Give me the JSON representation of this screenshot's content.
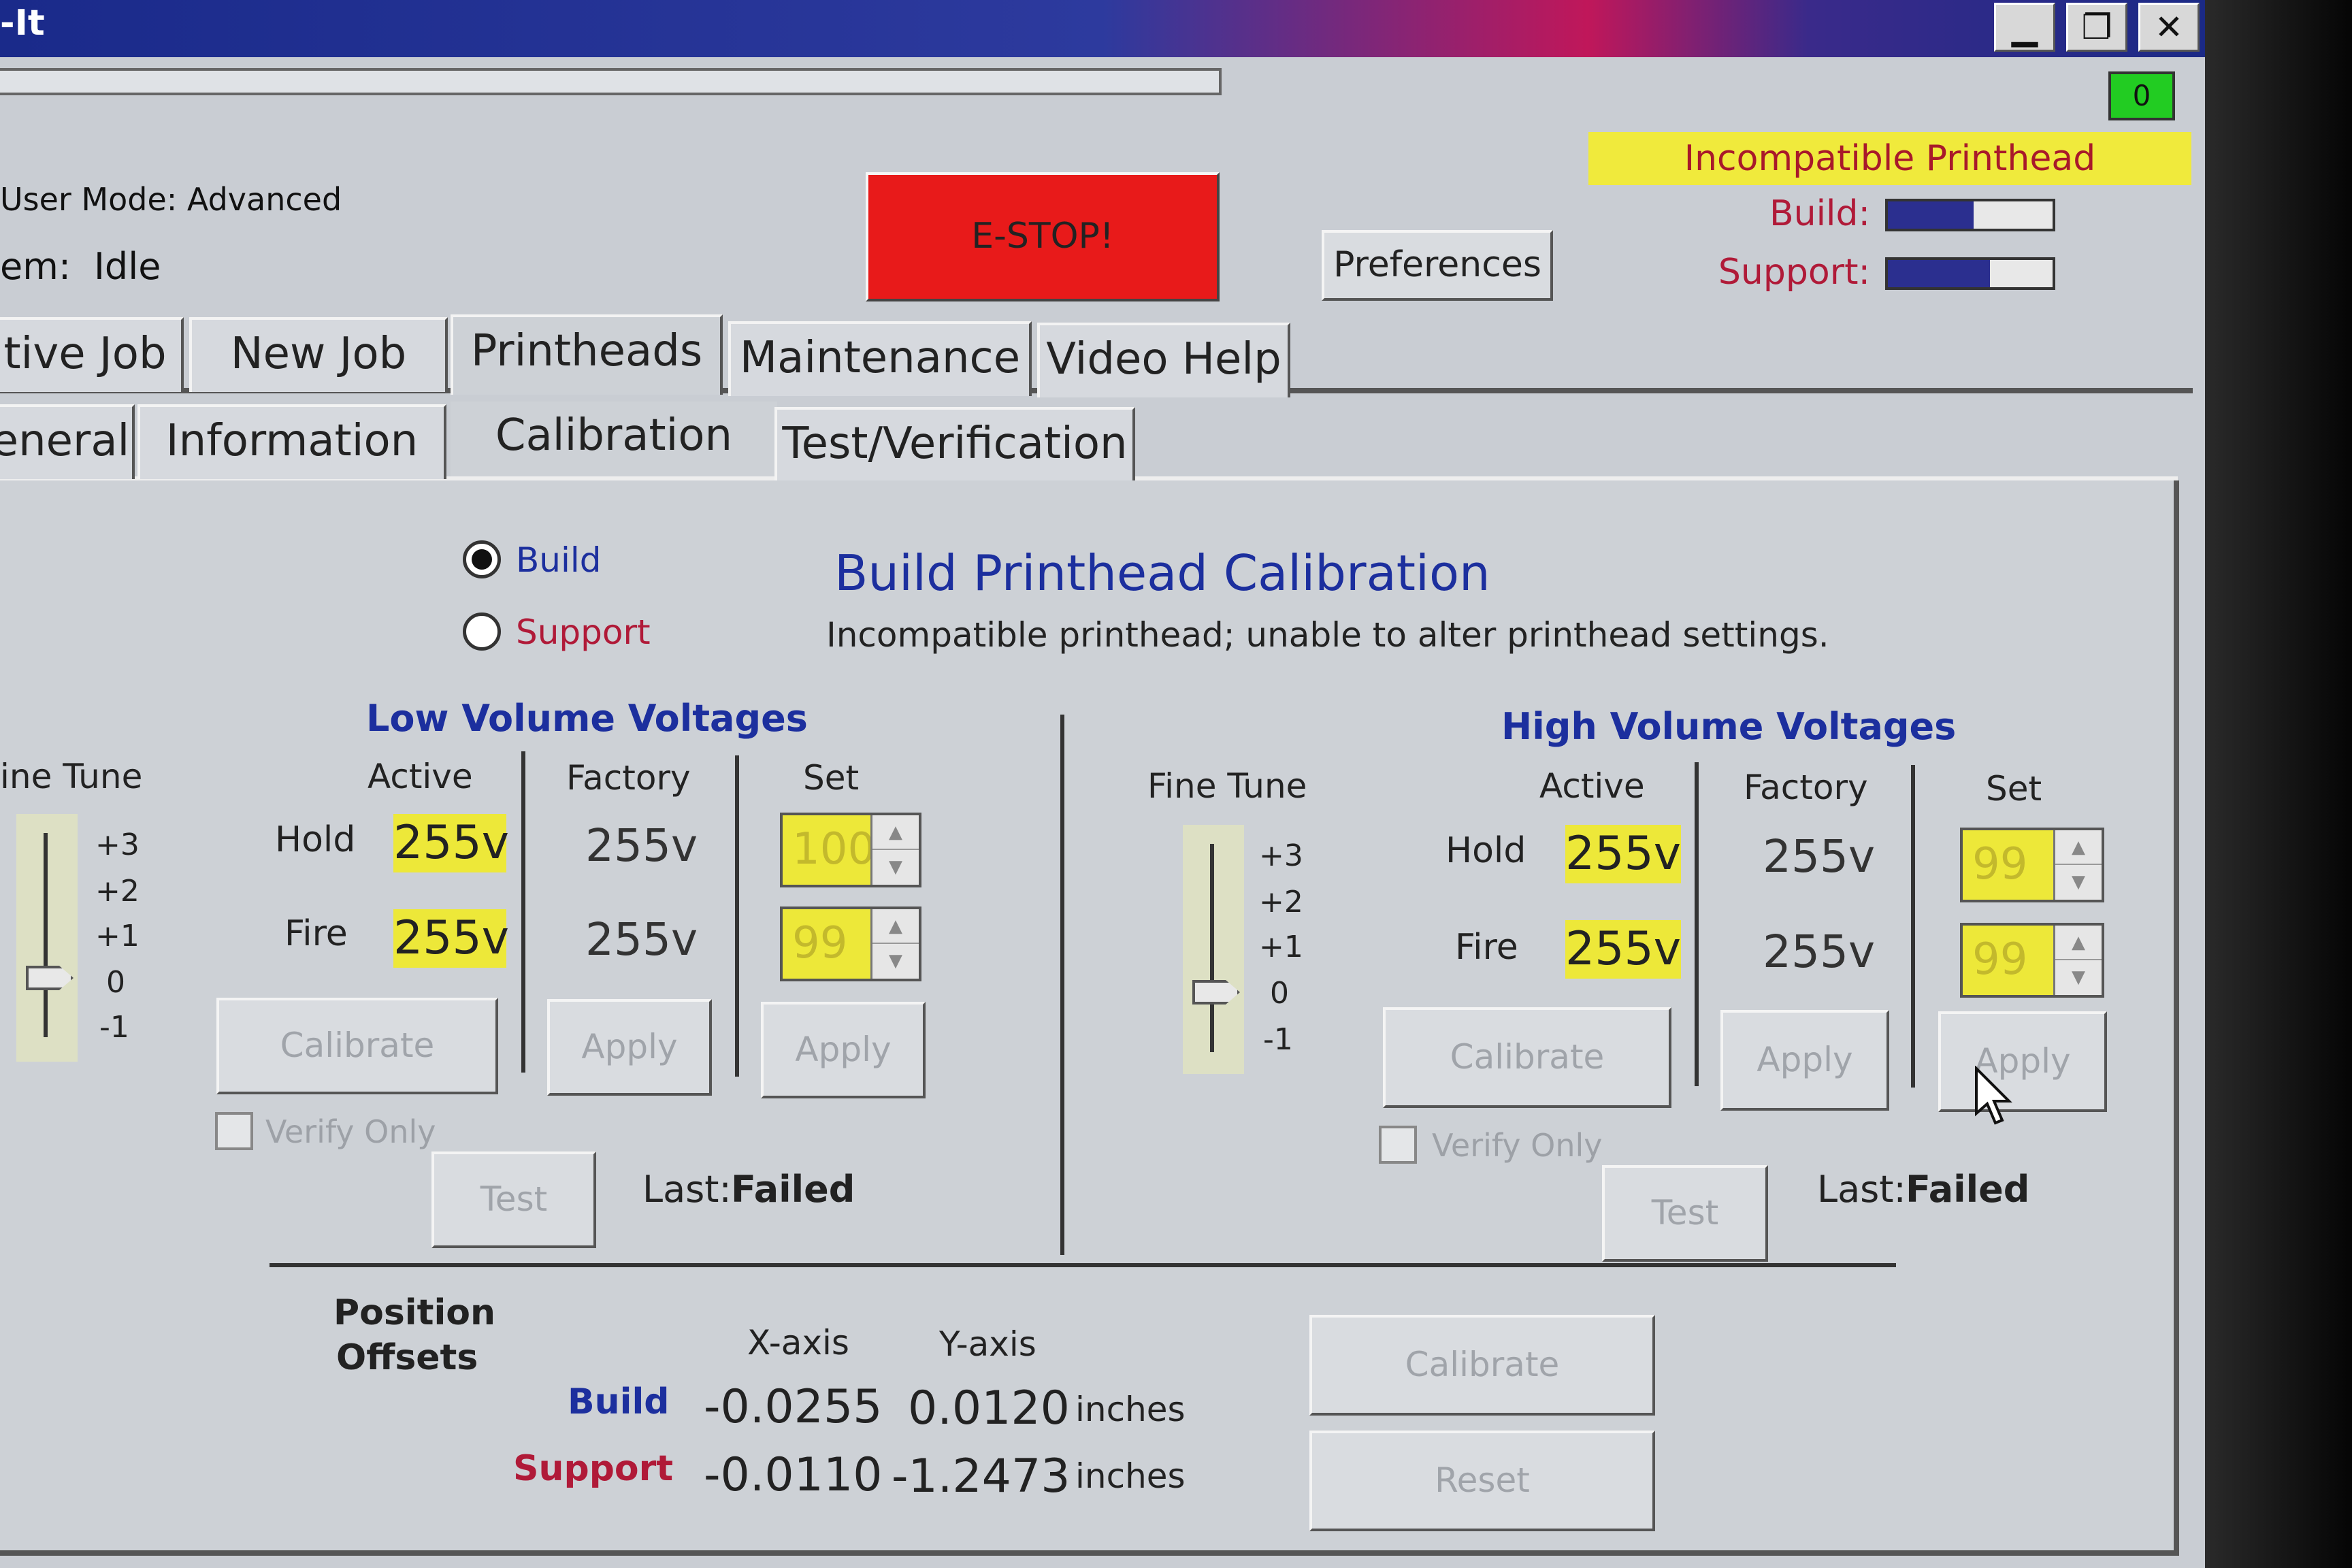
{
  "window": {
    "title": "-It",
    "controls": {
      "minimize": "▁",
      "restore": "❐",
      "close": "✕"
    }
  },
  "top": {
    "counter": "0",
    "user_mode": "User Mode: Advanced",
    "system_state_label": "em:",
    "system_state_value": "Idle",
    "estop_label": "E-STOP!",
    "preferences_label": "Preferences",
    "warning": "Incompatible Printhead",
    "build_meter": {
      "label": "Build:",
      "level_pct": 52
    },
    "support_meter": {
      "label": "Support:",
      "level_pct": 62
    }
  },
  "tabs": [
    {
      "label": "tive Job"
    },
    {
      "label": "New Job"
    },
    {
      "label": "Printheads",
      "active": true
    },
    {
      "label": "Maintenance"
    },
    {
      "label": "Video Help"
    }
  ],
  "subtabs": [
    {
      "label": "eneral"
    },
    {
      "label": "Information"
    },
    {
      "label": "Calibration",
      "active": true
    },
    {
      "label": "Test/Verification"
    }
  ],
  "calibration": {
    "radio_build": "Build",
    "radio_support": "Support",
    "radio_selected": "Build",
    "title": "Build Printhead Calibration",
    "message": "Incompatible printhead; unable to alter printhead settings."
  },
  "low": {
    "section_title": "Low Volume Voltages",
    "fine_tune_label": "ine Tune",
    "scale": [
      "+3",
      "+2",
      "+1",
      "0",
      "-1"
    ],
    "fine_tune_value": 0,
    "col_active": "Active",
    "col_factory": "Factory",
    "col_set": "Set",
    "hold_label": "Hold",
    "fire_label": "Fire",
    "hold_active": "255v",
    "fire_active": "255v",
    "hold_factory": "255v",
    "fire_factory": "255v",
    "hold_set": "100",
    "fire_set": "99",
    "calibrate_label": "Calibrate",
    "apply_factory_label": "Apply",
    "apply_set_label": "Apply",
    "verify_only_label": "Verify Only",
    "test_label": "Test",
    "last_label": "Last:",
    "last_value": "Failed"
  },
  "high": {
    "section_title": "High Volume Voltages",
    "fine_tune_label": "Fine Tune",
    "scale": [
      "+3",
      "+2",
      "+1",
      "0",
      "-1"
    ],
    "fine_tune_value": 0,
    "col_active": "Active",
    "col_factory": "Factory",
    "col_set": "Set",
    "hold_label": "Hold",
    "fire_label": "Fire",
    "hold_active": "255v",
    "fire_active": "255v",
    "hold_factory": "255v",
    "fire_factory": "255v",
    "hold_set": "99",
    "fire_set": "99",
    "calibrate_label": "Calibrate",
    "apply_factory_label": "Apply",
    "apply_set_label": "Apply",
    "verify_only_label": "Verify Only",
    "test_label": "Test",
    "last_label": "Last:",
    "last_value": "Failed"
  },
  "offsets": {
    "title_line1": "Position",
    "title_line2": "Offsets",
    "x_header": "X-axis",
    "y_header": "Y-axis",
    "build_label": "Build",
    "support_label": "Support",
    "build_x": "-0.0255",
    "build_y": "0.0120",
    "support_x": "-0.0110",
    "support_y": "-1.2473",
    "unit": "inches",
    "calibrate_label": "Calibrate",
    "reset_label": "Reset"
  },
  "colors": {
    "estop": "#e81a1a",
    "warning_bg": "#f0ea3c",
    "warning_text": "#a8192a",
    "active_value_bg": "#ede839",
    "accent_blue": "#1c2f9e",
    "accent_red": "#b01a38",
    "counter_bg": "#22cc22"
  }
}
